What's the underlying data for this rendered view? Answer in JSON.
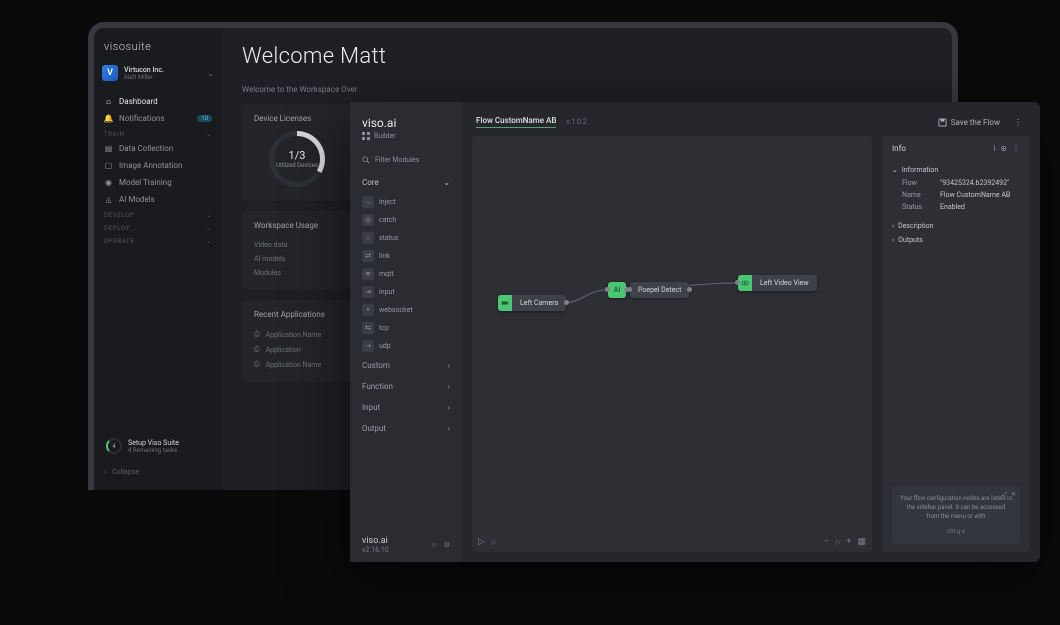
{
  "back": {
    "logo": "visosuite",
    "org": {
      "initial": "V",
      "name": "Virtucon Inc.",
      "user": "Matt Miller"
    },
    "nav": {
      "dashboard": "Dashboard",
      "notifications": "Notifications",
      "notif_count": "10",
      "train_label": "TRAIN",
      "train_items": [
        "Data Collection",
        "Image Annotation",
        "Model Training",
        "AI Models"
      ],
      "develop_label": "DEVELOP",
      "deploy_label": "DEPLOY",
      "operate_label": "OPERATE"
    },
    "setup": {
      "count": "4",
      "title": "Setup Viso Suite",
      "sub": "4 Remaining tasks"
    },
    "collapse": "Collapse",
    "main": {
      "welcome": "Welcome Matt",
      "subtitle": "Welcome to the Workspace Over",
      "licenses_title": "Device Licenses",
      "licenses_ratio": "1/3",
      "licenses_sub": "Utilized Devices",
      "usage_title": "Workspace Usage",
      "usage_rows": [
        "Video data",
        "AI models",
        "Modules"
      ],
      "recent_title": "Recent Applications",
      "recent_rows": [
        "Application Name",
        "Application",
        "Application Name"
      ]
    }
  },
  "front": {
    "logo": "viso.ai",
    "builder_label": "Builder",
    "filter_label": "Filter Modules",
    "groups": {
      "core": {
        "label": "Core",
        "items": [
          "inject",
          "catch",
          "status",
          "link",
          "mqtt",
          "input",
          "websocket",
          "tcp",
          "udp"
        ]
      },
      "custom": "Custom",
      "function": "Function",
      "input": "Input",
      "output": "Output"
    },
    "footer_logo": "viso.ai",
    "footer_version": "v2.16.10",
    "topbar": {
      "flow_name": "Flow CustomName AB",
      "version": "v.1.0.2",
      "save": "Save the Flow"
    },
    "nodes": {
      "left_camera": "Left Camera",
      "ai": "AI",
      "people_detect": "Poepel Detect",
      "left_video_view": "Left Video View"
    },
    "info": {
      "title": "Info",
      "information": "Information",
      "kv": {
        "flow_k": "Flow",
        "flow_v": "\"93425324.b2392492\"",
        "name_k": "Name",
        "name_v": "Flow CustomName AB",
        "status_k": "Status",
        "status_v": "Enabled"
      },
      "description": "Description",
      "outputs": "Outputs",
      "help_text": "Your flow configuration nodes are listed in the sidebar panel. It can be accessed from the menu or with",
      "shortcut": "ctrl-g    s"
    }
  }
}
